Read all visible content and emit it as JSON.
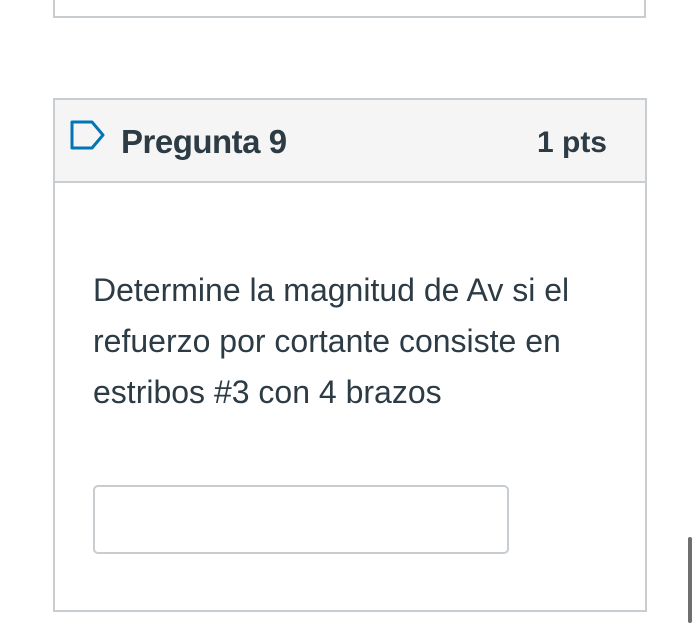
{
  "question": {
    "title": "Pregunta 9",
    "points": "1 pts",
    "text": "Determine la magnitud de Av si el refuerzo por cortante consiste en estribos #3 con 4 brazos",
    "answer_value": "",
    "flag_icon": "flag-icon"
  },
  "colors": {
    "text": "#2d3b45",
    "border": "#c7cdd1",
    "header_bg": "#f5f5f5",
    "flag": "#0374b5"
  }
}
